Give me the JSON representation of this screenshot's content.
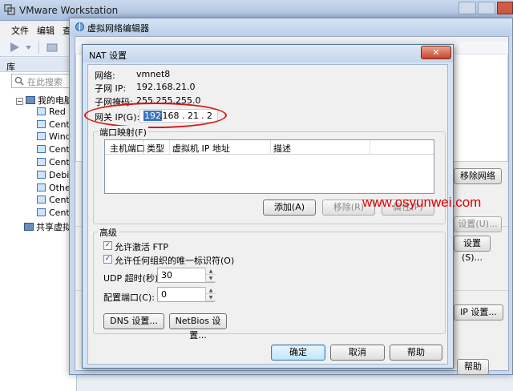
{
  "main_window": {
    "title": "VMware Workstation",
    "menu": [
      "文件",
      "编辑",
      "查"
    ],
    "library_title": "库",
    "search_placeholder": "在此搜索",
    "tree": {
      "root": "我的电脑",
      "vms": [
        "Red H",
        "CentC",
        "Windo",
        "CentC",
        "CentC",
        "Debia",
        "Other",
        "CentC",
        "CentC"
      ],
      "shared": "共享虚拟机"
    },
    "right_buttons": {
      "remove_network": "移除网络",
      "settings_u": "设置(U)...",
      "settings_s": "设置(S)...",
      "ip_settings": "IP 设置...",
      "help": "帮助"
    }
  },
  "vne_dialog": {
    "title": "虚拟网络编辑器"
  },
  "nat_dialog": {
    "title": "NAT 设置",
    "close_glyph": "✕",
    "network_label": "网络:",
    "network_value": "vmnet8",
    "subnet_ip_label": "子网 IP:",
    "subnet_ip_value": "192.168.21.0",
    "subnet_mask_label": "子网掩码:",
    "subnet_mask_value": "255.255.255.0",
    "gateway_label": "网关 IP(G):",
    "gateway_octets": [
      "192",
      ".168",
      ". 21",
      ". 2"
    ],
    "port_forwarding": {
      "title": "端口映射(F)",
      "columns": [
        "主机端口",
        "类型",
        "虚拟机 IP 地址",
        "描述"
      ],
      "add_button": "添加(A)",
      "remove_button": "移除(R)",
      "properties_button": "属性(P)"
    },
    "advanced": {
      "title": "高级",
      "allow_active_ftp": "允许激活 FTP",
      "allow_active_ftp_checked": true,
      "allow_any_oui": "允许任何组织的唯一标识符(O)",
      "allow_any_oui_checked": true,
      "udp_timeout_label": "UDP 超时(秒):",
      "udp_timeout_value": "30",
      "config_port_label": "配置端口(C):",
      "config_port_value": "0",
      "dns_button": "DNS 设置...",
      "netbios_button": "NetBios 设置..."
    },
    "ok_button": "确定",
    "cancel_button": "取消",
    "help_button": "帮助"
  },
  "watermark": "www.osyunwei.com",
  "colors": {
    "annotation_red": "#d81616",
    "watermark_red": "#e00000",
    "selection_blue": "#3a74c4"
  }
}
